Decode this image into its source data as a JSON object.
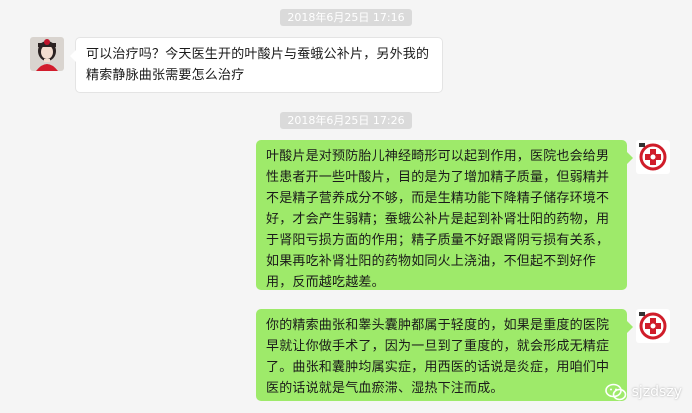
{
  "colors": {
    "background": "#f5f5f5",
    "timestamp_bg": "#dadada",
    "incoming_bubble": "#ffffff",
    "outgoing_bubble": "#9eea6a"
  },
  "messages": [
    {
      "type": "timestamp",
      "text": "2018年6月25日 17:16"
    },
    {
      "type": "incoming",
      "avatar_icon": "female-user-avatar",
      "text": "可以治疗吗？今天医生开的叶酸片与蚕蛾公补片，另外我的精索静脉曲张需要怎么治疗"
    },
    {
      "type": "timestamp",
      "text": "2018年6月25日 17:26"
    },
    {
      "type": "outgoing",
      "avatar_icon": "clinic-logo-avatar",
      "text": "叶酸片是对预防胎儿神经畸形可以起到作用，医院也会给男性患者开一些叶酸片，目的是为了增加精子质量，但弱精并不是精子营养成分不够，而是生精功能下降精子储存环境不好，才会产生弱精；蚕蛾公补片是起到补肾壮阳的药物，用于肾阳亏损方面的作用；精子质量不好跟肾阴亏损有关系，如果再吃补肾壮阳的药物如同火上浇油，不但起不到好作用，反而越吃越差。"
    },
    {
      "type": "outgoing",
      "avatar_icon": "clinic-logo-avatar",
      "text": "你的精索曲张和睾头囊肿都属于轻度的，如果是重度的医院早就让你做手术了，因为一旦到了重度的，就会形成无精症了。曲张和囊肿均属实症，用西医的话说是炎症，用咱们中医的话说就是气血瘀滞、湿热下注而成。"
    }
  ],
  "watermark": {
    "icon": "wechat-icon",
    "text": "sjzdszy"
  }
}
